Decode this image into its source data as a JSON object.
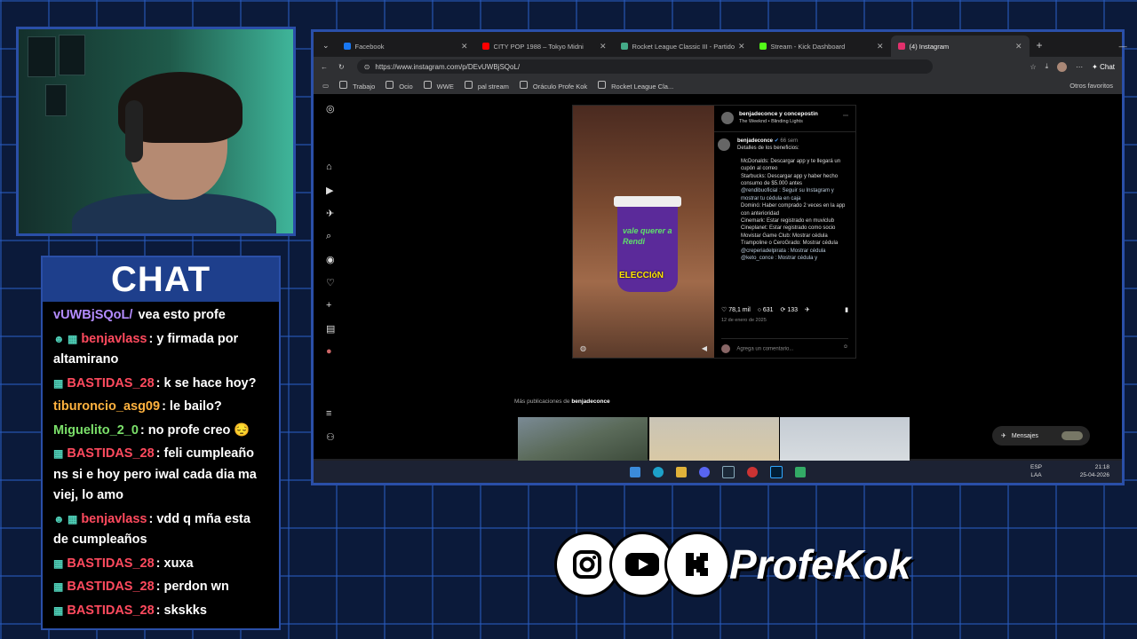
{
  "chat": {
    "title": "CHAT",
    "messages": [
      {
        "badge": "",
        "user": "vUWBjSQoL/",
        "user_color": "#b48cff",
        "text": " vea esto profe"
      },
      {
        "badge": "☻ ▦",
        "user": "benjavlass",
        "user_color": "#ff4a5e",
        "text": ": y firmada por altamirano"
      },
      {
        "badge": "▦",
        "user": "BASTIDAS_28",
        "user_color": "#ff4a5e",
        "text": ": k se hace hoy?"
      },
      {
        "badge": "",
        "user": "tiburoncio_asg09",
        "user_color": "#ffb23f",
        "text": ": le bailo?"
      },
      {
        "badge": "",
        "user": "Miguelito_2_0",
        "user_color": "#7be06a",
        "text": ": no profe creo 😔"
      },
      {
        "badge": "▦",
        "user": "BASTIDAS_28",
        "user_color": "#ff4a5e",
        "text": ": feli cumpleaño ns si e hoy pero iwal cada dia ma viej, lo amo"
      },
      {
        "badge": "☻ ▦",
        "user": "benjavlass",
        "user_color": "#ff4a5e",
        "text": ": vdd q mña esta de cumpleaños"
      },
      {
        "badge": "▦",
        "user": "BASTIDAS_28",
        "user_color": "#ff4a5e",
        "text": ": xuxa"
      },
      {
        "badge": "▦",
        "user": "BASTIDAS_28",
        "user_color": "#ff4a5e",
        "text": ": perdon wn"
      },
      {
        "badge": "▦",
        "user": "BASTIDAS_28",
        "user_color": "#ff4a5e",
        "text": ": skskks"
      }
    ]
  },
  "browser": {
    "tabs": [
      {
        "label": "Facebook",
        "color": "#1877f2",
        "active": false
      },
      {
        "label": "CITY POP 1988 – Tokyo Midni",
        "color": "#ff0000",
        "active": false
      },
      {
        "label": "Rocket League Classic III - Partido",
        "color": "#4a8",
        "active": false
      },
      {
        "label": "Stream - Kick Dashboard",
        "color": "#53fc18",
        "active": false
      },
      {
        "label": "(4) Instagram",
        "color": "#e1306c",
        "active": true
      }
    ],
    "url": "https://www.instagram.com/p/DEvUWBjSQoL/",
    "chat_button": "Chat",
    "bookmarks": [
      "Trabajo",
      "Ocio",
      "WWE",
      "pal stream",
      "Oráculo Profe Kok",
      "Rocket League Cla..."
    ],
    "other_bookmarks": "Otros favoritos"
  },
  "post": {
    "author": "benjadeconce y concepostin",
    "song": "The Weeknd • Blinding Lights",
    "caption_user": "benjadeconce",
    "caption_time": "66 sem",
    "caption_intro": "Detalles de los beneficios:",
    "benefits": [
      "McDonalds: Descargar app y te llegará un cupón al correo",
      "Starbucks: Descargar app y haber hecho consumo de $5.000 antes",
      "@rendibuoficial : Seguir su Instagram y mostrar tu cédula en caja",
      "Dominó: Haber comprado 2 veces en la app con anterioridad",
      "Cinemark: Estar registrado en muviclub",
      "Cineplanet: Estar registrado como socio",
      "Movistar Game Club: Mostrar cédula",
      "Trampoline o CeroGrado: Mostrar cédula",
      "@creperiadelpirata : Mostrar cédula",
      "@keto_conce : Mostrar cédula y"
    ],
    "likes": "78,1 mil",
    "comments": "631",
    "reposts": "133",
    "date": "12 de enero de 2025",
    "comment_placeholder": "Agrega un comentario...",
    "cup_text": "vale querer a Rendi",
    "video_overlay": "ELECCIóN",
    "more_from": "Más publicaciones de",
    "more_user": "benjadeconce",
    "messages_label": "Mensajes",
    "notif_count": "4"
  },
  "taskbar": {
    "lang": "ESP",
    "layout": "LAA",
    "time": "21:18",
    "date": "25-04-2026"
  },
  "brand": {
    "name": "ProfeKok",
    "grid_color": "#2a5abe"
  }
}
